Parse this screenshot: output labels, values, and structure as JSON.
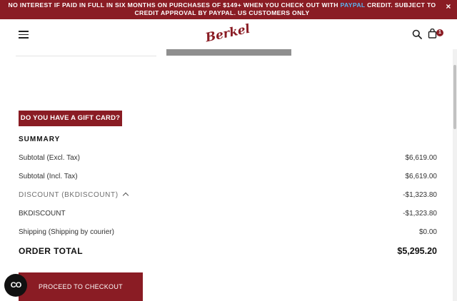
{
  "promo": {
    "text_before": "NO INTEREST IF PAID IN FULL IN SIX MONTHS ON PURCHASES OF $149+ WHEN YOU CHECK OUT WITH ",
    "paypal": "PAYPAL",
    "text_after": " CREDIT. SUBJECT TO CREDIT APPROVAL BY PAYPAL. US CUSTOMERS ONLY",
    "close": "×",
    "paypal_color": "#5ab4f0",
    "bar_color": "#8a1c24"
  },
  "header": {
    "logo": "Berkel",
    "cart_count": "1",
    "icons": [
      "menu-icon",
      "search-icon",
      "bag-icon"
    ]
  },
  "gift_card": {
    "label": "DO YOU HAVE A GIFT CARD?"
  },
  "summary": {
    "title": "SUMMARY",
    "rows": [
      {
        "label": "Subtotal (Excl. Tax)",
        "value": "$6,619.00"
      },
      {
        "label": "Subtotal (Incl. Tax)",
        "value": "$6,619.00"
      },
      {
        "label": "DISCOUNT (BKDISCOUNT)",
        "value": "-$1,323.80"
      },
      {
        "label": "BKDISCOUNT",
        "value": "-$1,323.80"
      },
      {
        "label": "Shipping (Shipping by courier)",
        "value": "$0.00"
      }
    ],
    "total_label": "ORDER TOTAL",
    "total_value": "$5,295.20"
  },
  "checkout": {
    "label": "PROCEED TO CHECKOUT"
  },
  "cookie_button": {
    "label": "CO"
  }
}
